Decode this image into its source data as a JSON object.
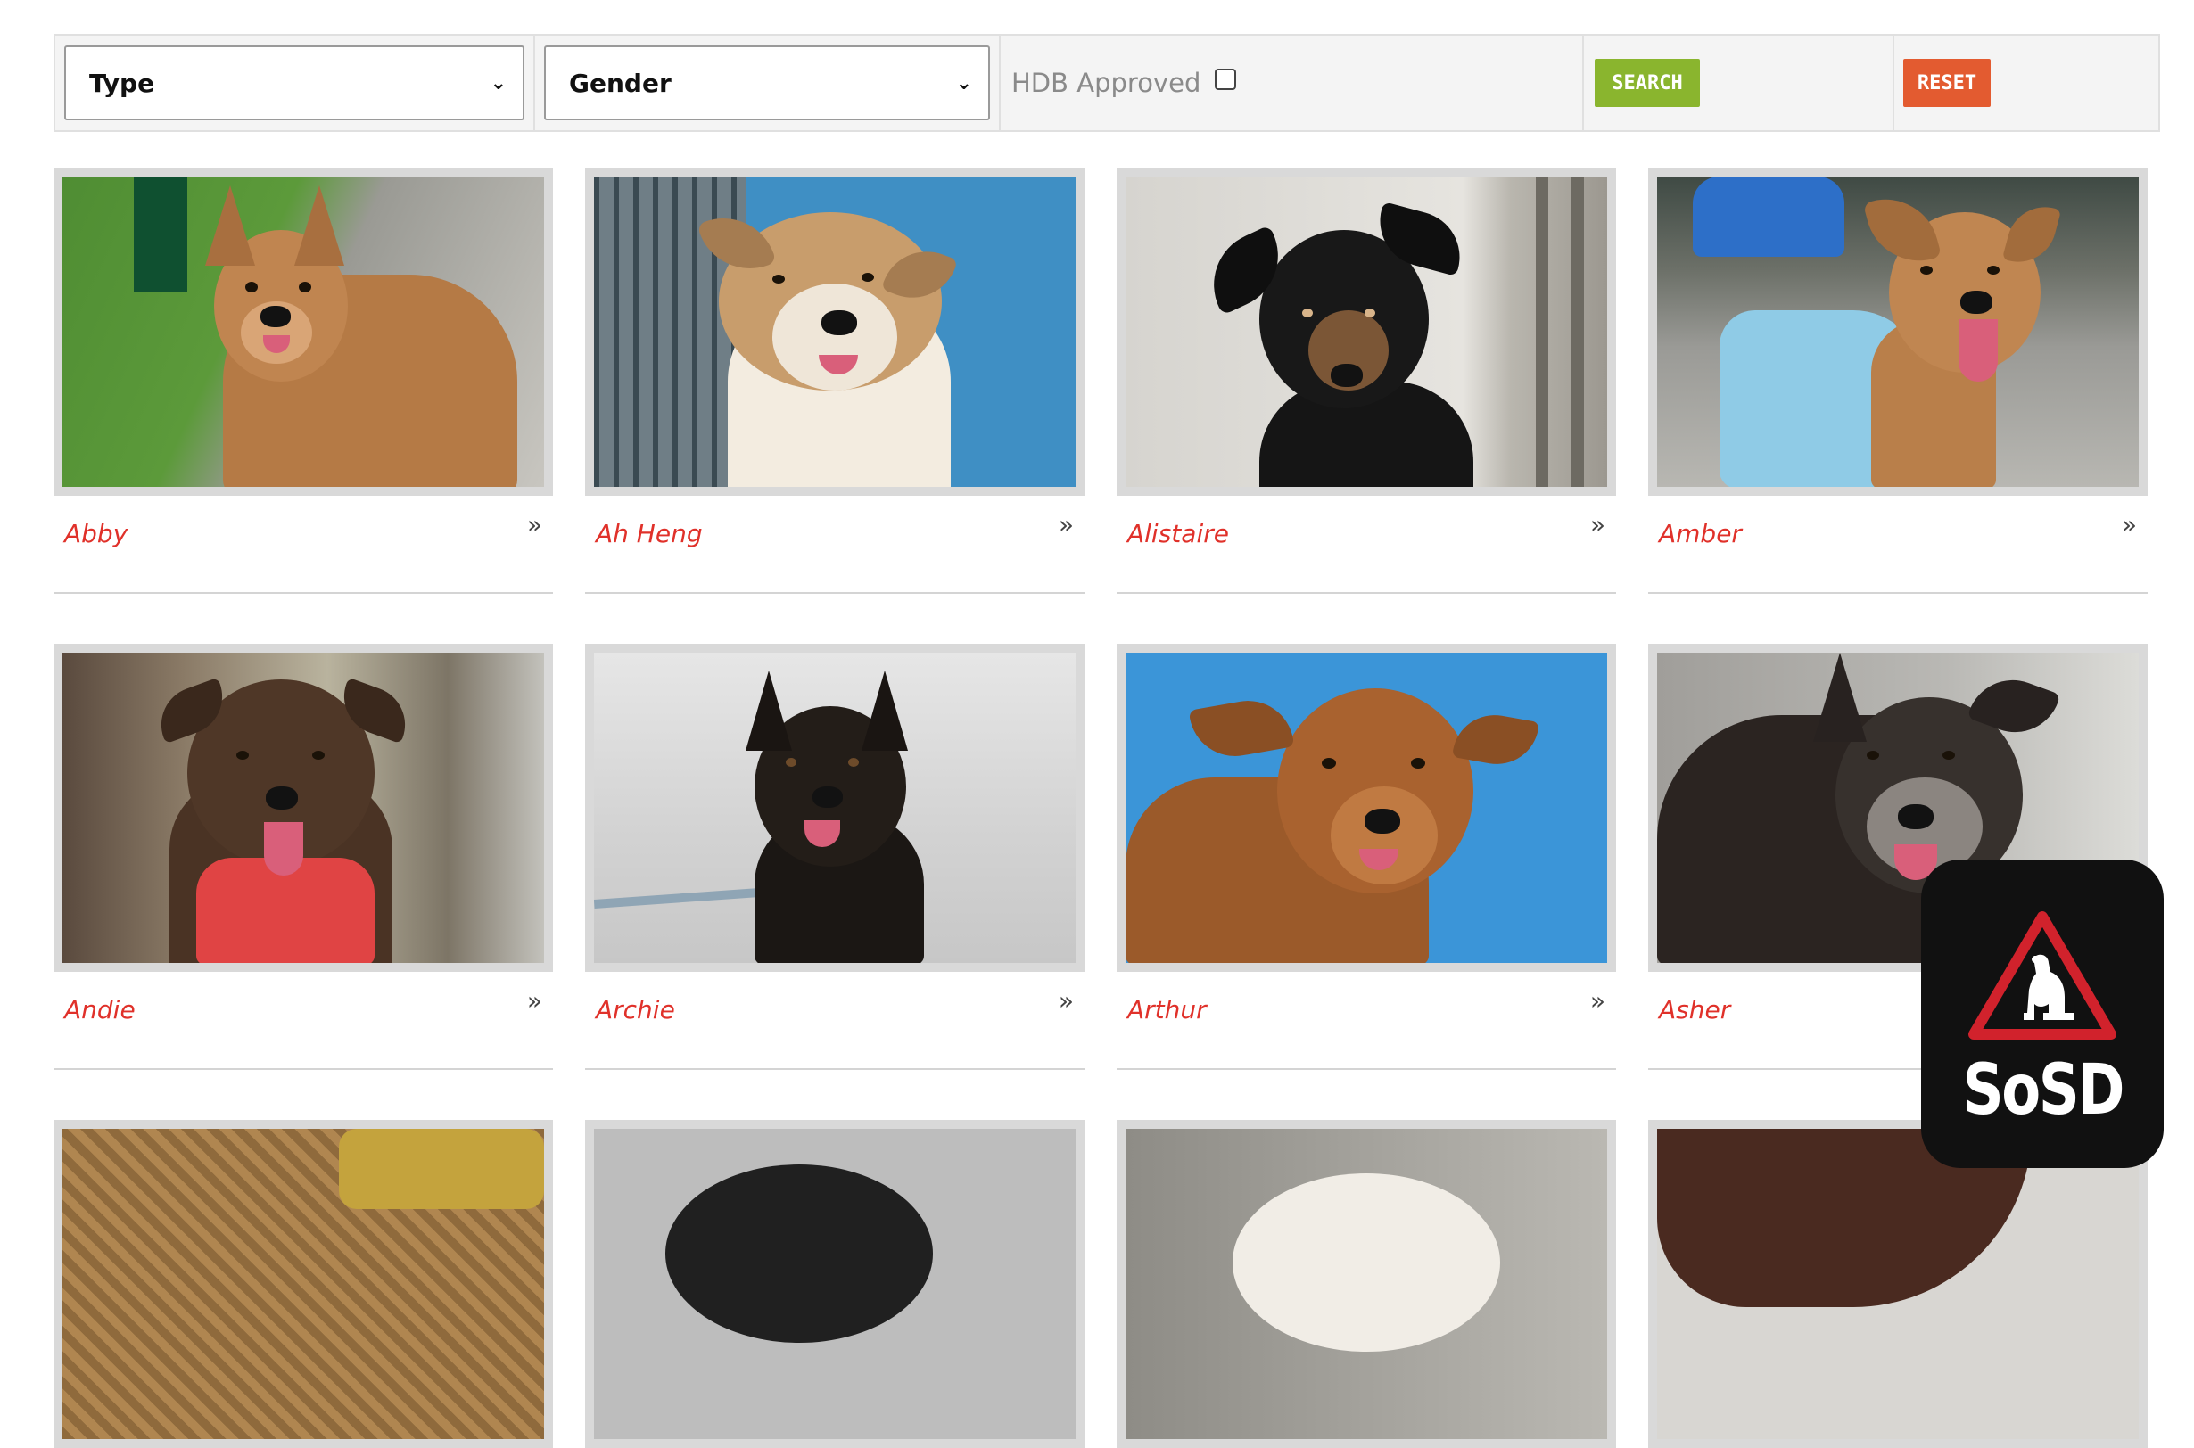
{
  "filters": {
    "type_select": {
      "value": "Type"
    },
    "gender_select": {
      "value": "Gender"
    },
    "hdb_label": "HDB Approved",
    "hdb_checked": false,
    "search_label": "SEARCH",
    "reset_label": "RESET"
  },
  "colors": {
    "search_green": "#8ab52e",
    "reset_orange": "#e35b30",
    "name_red": "#e0312a"
  },
  "dogs": [
    {
      "name": "Abby",
      "arrow": "»"
    },
    {
      "name": "Ah Heng",
      "arrow": "»"
    },
    {
      "name": "Alistaire",
      "arrow": "»"
    },
    {
      "name": "Amber",
      "arrow": "»"
    },
    {
      "name": "Andie",
      "arrow": "»"
    },
    {
      "name": "Archie",
      "arrow": "»"
    },
    {
      "name": "Arthur",
      "arrow": "»"
    },
    {
      "name": "Asher",
      "arrow": ""
    }
  ],
  "badge": {
    "text": "SoSD",
    "icon": "dog-warning-triangle-icon"
  }
}
